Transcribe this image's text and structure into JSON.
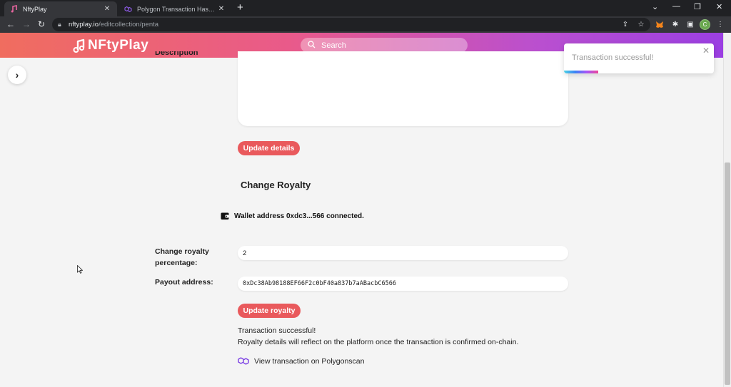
{
  "browser": {
    "tabs": [
      {
        "title": "NftyPlay",
        "active": true
      },
      {
        "title": "Polygon Transaction Hash (Txhash)",
        "active": false
      }
    ],
    "url_host": "nftyplay.io",
    "url_path": "/editcollection/penta",
    "profile_initial": "C"
  },
  "header": {
    "logo_text": "NFtyPlay",
    "search_placeholder": "Search"
  },
  "form": {
    "description_label": "Description",
    "update_details_label": "Update details",
    "royalty_section_title": "Change Royalty",
    "wallet_status": "Wallet address 0xdc3...566 connected.",
    "royalty_label": "Change royalty percentage:",
    "royalty_value": "2",
    "payout_label": "Payout address:",
    "payout_value": "0xDc38Ab98188EF66F2c0bF40a837b7aABacbC6566",
    "update_royalty_label": "Update royalty",
    "success_line1": "Transaction successful!",
    "success_line2": "Royalty details will reflect on the platform once the transaction is confirmed on-chain.",
    "view_tx_label": "View transaction on Polygonscan"
  },
  "toast": {
    "message": "Transaction successful!",
    "progress_remaining": 0.23
  },
  "colors": {
    "accent": "#e9595c",
    "header_start": "#f06d5f",
    "header_end": "#9b3fe2"
  }
}
